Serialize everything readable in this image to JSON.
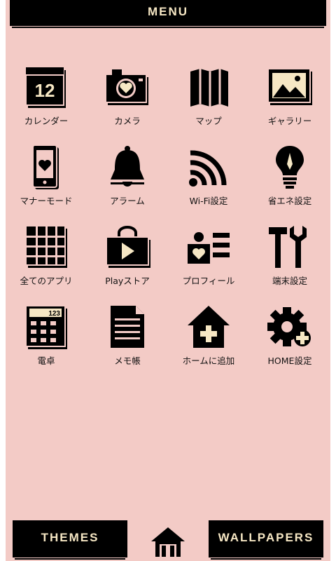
{
  "header": {
    "title": "MENU"
  },
  "apps": [
    {
      "label": "カレンダー",
      "icon": "calendar-icon",
      "day": "12"
    },
    {
      "label": "カメラ",
      "icon": "camera-icon"
    },
    {
      "label": "マップ",
      "icon": "map-icon"
    },
    {
      "label": "ギャラリー",
      "icon": "gallery-icon"
    },
    {
      "label": "マナーモード",
      "icon": "phone-heart-icon"
    },
    {
      "label": "アラーム",
      "icon": "bell-icon"
    },
    {
      "label": "Wi-Fi設定",
      "icon": "wifi-icon"
    },
    {
      "label": "省エネ設定",
      "icon": "lightbulb-icon"
    },
    {
      "label": "全てのアプリ",
      "icon": "app-grid-icon"
    },
    {
      "label": "Playストア",
      "icon": "play-store-icon"
    },
    {
      "label": "プロフィール",
      "icon": "profile-icon"
    },
    {
      "label": "端末設定",
      "icon": "tools-icon"
    },
    {
      "label": "電卓",
      "icon": "calculator-icon",
      "display": "123"
    },
    {
      "label": "メモ帳",
      "icon": "memo-icon"
    },
    {
      "label": "ホームに追加",
      "icon": "house-plus-icon"
    },
    {
      "label": "HOME設定",
      "icon": "gear-plus-icon"
    }
  ],
  "footer": {
    "themes_label": "THEMES",
    "wallpapers_label": "WALLPAPERS",
    "home_icon": "home-icon"
  },
  "colors": {
    "background": "#f3cbc6",
    "ink": "#000000",
    "cream": "#f6e7c4"
  }
}
